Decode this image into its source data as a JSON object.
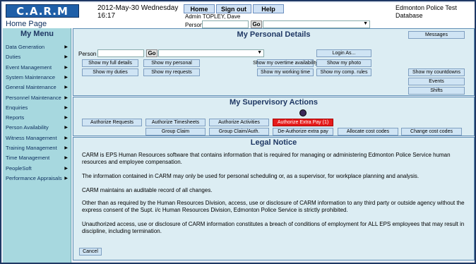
{
  "app": {
    "logo": "C.A.R.M",
    "page": "Home Page"
  },
  "header": {
    "date": "2012-May-30 Wednesday",
    "time": "16:17",
    "user": "Admin TOPLEY, Dave",
    "person_label": "Person",
    "go": "Go",
    "buttons": {
      "home": "Home",
      "signout": "Sign out",
      "help": "Help"
    },
    "database": "Edmonton Police Test Database"
  },
  "menu": {
    "title": "My Menu",
    "items": [
      "Data Generation",
      "Duties",
      "Event Management",
      "System Maintenance",
      "General Maintenance",
      "Personnel Maintenance",
      "Enquiries",
      "Reports",
      "Person Availability",
      "Witness Management",
      "Training Management",
      "Time Management",
      "PeopleSoft",
      "Performance Appraisals"
    ]
  },
  "personal": {
    "title": "My Personal Details",
    "messages": "Messages",
    "person_label": "Person",
    "go": "Go",
    "login_as": "Login As...",
    "full_details": "Show my full details",
    "show_personal": "Show my personal",
    "overtime": "Show my overtime availability",
    "photo": "Show my photo",
    "duties": "Show my duties",
    "requests": "Show my requests",
    "working_time": "Show my working time",
    "comp_rules": "Show my comp. rules",
    "countdowns": "Show my countdowns",
    "events": "Events",
    "shifts": "Shifts"
  },
  "supervisory": {
    "title": "My Supervisory Actions",
    "auth_requests": "Authorize Requests",
    "auth_timesheets": "Authorize Timesheets",
    "auth_activities": "Authorize Activities",
    "auth_extra_pay": "Authorize Extra Pay (1)",
    "group_claim": "Group Claim",
    "group_claim_auth": "Group Claim/Auth.",
    "deauth_extra_pay": "De-Authorize extra pay",
    "allocate_cost": "Allocate cost codes",
    "change_cost": "Change cost codes"
  },
  "legal": {
    "title": "Legal Notice",
    "p1": "CARM is EPS Human Resources software that contains information that is required for managing or administering Edmonton Police Service human resources and employee compensation.",
    "p2": "The information contained in CARM may only be used for personal scheduling or, as a supervisor, for workplace planning and analysis.",
    "p3": "CARM maintains an auditable record of all changes.",
    "p4": "Other than as required by the Human Resources Division, access, use or disclosure of CARM information to any third party or outside agency without the express consent of the Supt. i/c Human Resources Division, Edmonton Police Service is strictly prohibited.",
    "p5": "Unauthorized access, use or disclosure of CARM information constitutes a breach of conditions of employment for ALL EPS employees that may result in discipline, including termination.",
    "cancel": "Cancel"
  },
  "colors": {
    "menu_bg": "#a7d8df",
    "panel_bg": "#dcedf3",
    "alert": "#e51c1c",
    "title": "#1f3864"
  }
}
